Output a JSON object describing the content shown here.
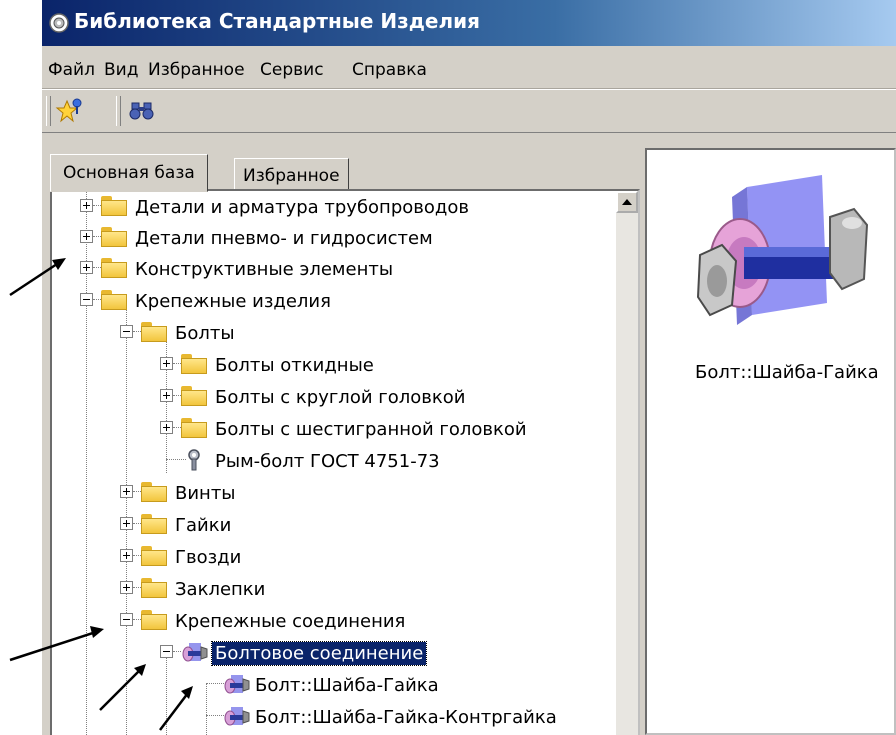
{
  "window": {
    "title": "Библиотека Стандартные Изделия"
  },
  "menu": {
    "items": [
      "Файл",
      "Вид",
      "Избранное",
      "Сервис",
      "Справка"
    ]
  },
  "tabs": {
    "active": "Основная база",
    "inactive": "Избранное"
  },
  "tree": {
    "items": [
      "Детали и арматура трубопроводов",
      "Детали пневмо- и гидросистем",
      "Конструктивные элементы",
      "Крепежные изделия",
      "Болты",
      "Болты откидные",
      "Болты с круглой головкой",
      "Болты с шестигранной головкой",
      "Рым-болт ГОСТ 4751-73",
      "Винты",
      "Гайки",
      "Гвозди",
      "Заклепки",
      "Крепежные соединения",
      "Болтовое соединение",
      "Болт::Шайба-Гайка",
      "Болт::Шайба-Гайка-Контргайка"
    ],
    "selected": "Болтовое соединение"
  },
  "preview": {
    "caption": "Болт::Шайба-Гайка"
  }
}
